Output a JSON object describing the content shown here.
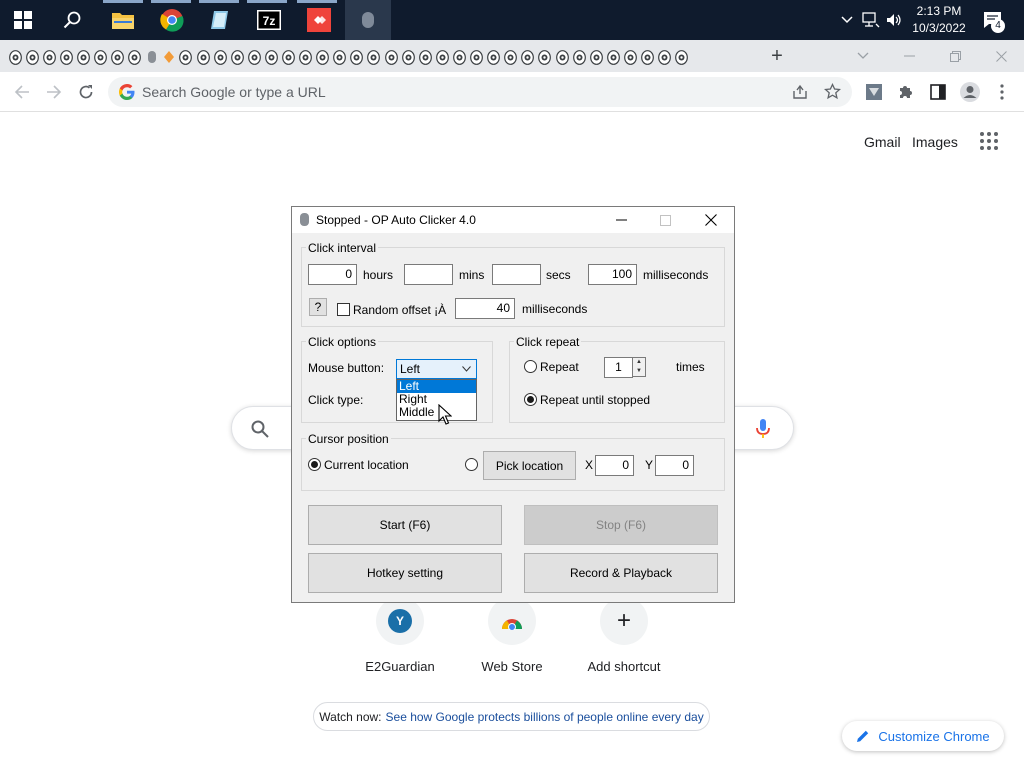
{
  "taskbar": {
    "time": "2:13 PM",
    "date": "10/3/2022",
    "notifications_count": "4",
    "pinned_apps": [
      "start-icon",
      "search-icon",
      "file-explorer-icon",
      "chrome-icon",
      "notepad-icon",
      "7zip-icon",
      "anydesk-icon",
      "auto-clicker-taskbar-icon"
    ]
  },
  "browser": {
    "new_tab_symbol": "+",
    "omnibox_placeholder": "Search Google or type a URL"
  },
  "google": {
    "gmail": "Gmail",
    "images": "Images",
    "shortcuts": [
      {
        "label": "E2Guardian",
        "letter": "Y"
      },
      {
        "label": "Web Store"
      },
      {
        "label": "Add shortcut",
        "symbol": "+"
      }
    ],
    "watch_prefix": "Watch now:",
    "watch_link": "See how Google protects billions of people online every day",
    "customize_label": "Customize Chrome"
  },
  "dialog": {
    "title": "Stopped - OP Auto Clicker 4.0",
    "click_interval": {
      "label": "Click interval",
      "hours_value": "0",
      "hours_label": "hours",
      "mins_value": "",
      "mins_label": "mins",
      "secs_value": "",
      "secs_label": "secs",
      "ms_value": "100",
      "ms_label": "milliseconds",
      "help_label": "?",
      "random_offset_label": "Random offset ¡À",
      "random_offset_checked": false,
      "offset_value": "40",
      "offset_unit": "milliseconds"
    },
    "click_options": {
      "label": "Click options",
      "mouse_button_label": "Mouse button:",
      "mouse_button_value": "Left",
      "options": [
        "Left",
        "Right",
        "Middle"
      ],
      "click_type_label": "Click type:"
    },
    "click_repeat": {
      "label": "Click repeat",
      "repeat_label": "Repeat",
      "repeat_value": "1",
      "times_label": "times",
      "until_stopped_label": "Repeat until stopped",
      "selected": "until_stopped"
    },
    "cursor_position": {
      "label": "Cursor position",
      "current_label": "Current location",
      "pick_label": "Pick location",
      "x_label": "X",
      "x_value": "0",
      "y_label": "Y",
      "y_value": "0",
      "selected": "current"
    },
    "buttons": {
      "start": "Start (F6)",
      "stop": "Stop (F6)",
      "hotkey": "Hotkey setting",
      "record": "Record & Playback"
    }
  },
  "colors": {
    "taskbar_bg": "#0f1b2d",
    "chrome_blue": "#1a73e8",
    "selection_blue": "#0078d7"
  }
}
